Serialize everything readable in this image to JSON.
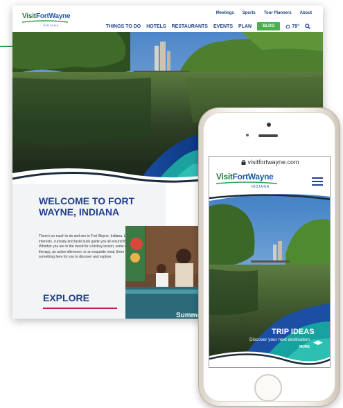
{
  "site": {
    "logo_main": "Visit",
    "logo_brand": "FortWayne",
    "logo_sub": "INDIANA"
  },
  "utility_nav": [
    "Meetings",
    "Sports",
    "Tour Planners",
    "About"
  ],
  "main_nav": [
    "THINGS TO DO",
    "HOTELS",
    "RESTAURANTS",
    "EVENTS",
    "PLAN"
  ],
  "blog_label": "BLOG",
  "weather": "79°",
  "intro": {
    "heading": "WELCOME TO FORT WAYNE, INDIANA",
    "body": "There's so much to do and see in Fort Wayne, Indiana. Let your interests, curiosity and taste buds guide you all around the city. Whether you are in the mood for a history lesson, some retail therapy, an active afternoon, or an exquisite meal, there is something here for you to discover and explore.",
    "explore_label": "EXPLORE"
  },
  "card_label": "Summe",
  "mobile": {
    "url": "visitfortwayne.com",
    "slide_title": "TRIP IDEAS",
    "slide_subtitle": "Discover your next destination",
    "slide_more": "MORE"
  },
  "colors": {
    "brand_blue": "#1e3f8a",
    "brand_green": "#2aa54a",
    "accent_pink": "#c2185b"
  }
}
